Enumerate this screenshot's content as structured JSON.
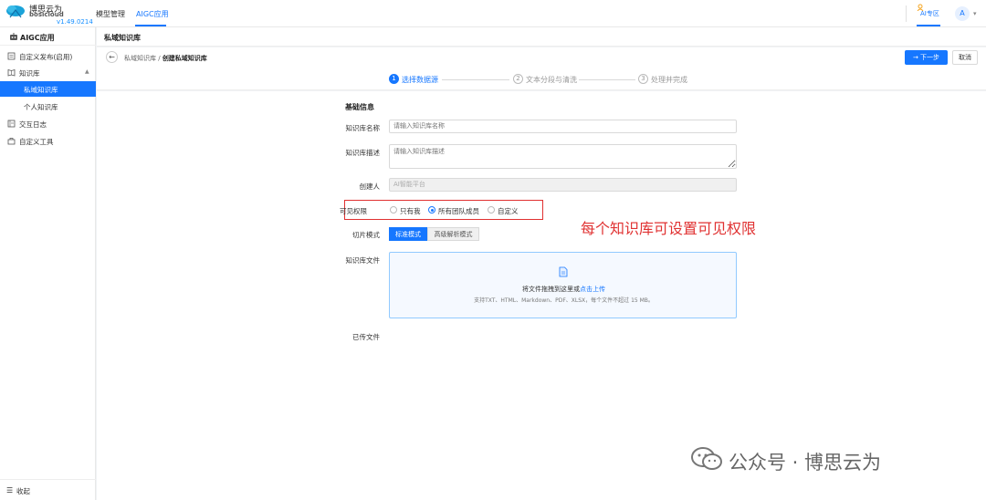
{
  "brand": {
    "name_cn": "博思云为",
    "name_en": "bosicloud",
    "version": "v1.49.0214"
  },
  "top_nav": {
    "items": [
      {
        "label": "模型管理"
      },
      {
        "label": "AIGC应用"
      }
    ],
    "ai_zone": "AI专区",
    "avatar_letter": "A"
  },
  "sidebar": {
    "title": "AIGC应用",
    "items": [
      {
        "label": "自定义发布(启用)"
      },
      {
        "label": "知识库"
      },
      {
        "label": "私域知识库"
      },
      {
        "label": "个人知识库"
      },
      {
        "label": "交互日志"
      },
      {
        "label": "自定义工具"
      }
    ],
    "collapse_label": "收起"
  },
  "page": {
    "title": "私域知识库",
    "breadcrumb_parent": "私域知识库",
    "breadcrumb_sep": " / ",
    "breadcrumb_current": "创建私域知识库",
    "next_label": "→ 下一步",
    "cancel_label": "取消"
  },
  "steps": [
    {
      "num": "1",
      "label": "选择数据源"
    },
    {
      "num": "2",
      "label": "文本分段与清洗"
    },
    {
      "num": "3",
      "label": "处理并完成"
    }
  ],
  "form": {
    "section_title": "基础信息",
    "name_label": "知识库名称",
    "name_placeholder": "请输入知识库名称",
    "desc_label": "知识库描述",
    "desc_placeholder": "请输入知识库描述",
    "creator_label": "创建人",
    "creator_value": "AI智能平台",
    "perm_label": "可见权限",
    "perm_options": [
      {
        "label": "只有我"
      },
      {
        "label": "所有团队成员"
      },
      {
        "label": "自定义"
      }
    ],
    "slice_label": "切片模式",
    "slice_options": [
      {
        "label": "标准模式"
      },
      {
        "label": "高级解析模式"
      }
    ],
    "file_label": "知识库文件",
    "upload_text": "将文件拖拽到这里或",
    "upload_link": "点击上传",
    "upload_hint": "支持TXT、HTML、Markdown、PDF、XLSX，每个文件不超过 15 MB。",
    "uploaded_label": "已传文件"
  },
  "annotation": "每个知识库可设置可见权限",
  "watermark": "公众号 · 博思云为",
  "colors": {
    "primary": "#1677ff",
    "highlight": "#e03131"
  }
}
